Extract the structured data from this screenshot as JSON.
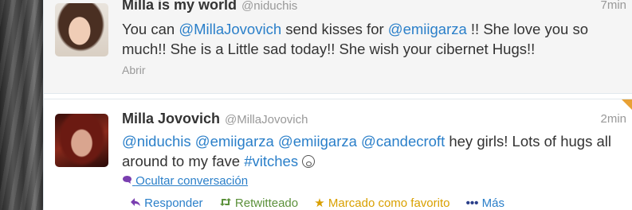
{
  "tweets": [
    {
      "fullname": "Milla is my world",
      "username": "@niduchis",
      "time": "7min",
      "text_parts": [
        {
          "t": "You can ",
          "k": "text"
        },
        {
          "t": "@MillaJovovich",
          "k": "mention"
        },
        {
          "t": " send kisses for ",
          "k": "text"
        },
        {
          "t": "@emiigarza",
          "k": "mention"
        },
        {
          "t": " !! She love you so much!! She is a Little sad today!! She wish your cibernet Hugs!!",
          "k": "text"
        }
      ],
      "expand_label": "Abrir"
    },
    {
      "fullname": "Milla Jovovich",
      "username": "@MillaJovovich",
      "time": "2min",
      "text_parts": [
        {
          "t": "@niduchis",
          "k": "mention"
        },
        {
          "t": " ",
          "k": "text"
        },
        {
          "t": "@emiigarza",
          "k": "mention"
        },
        {
          "t": " ",
          "k": "text"
        },
        {
          "t": "@emiigarza",
          "k": "mention"
        },
        {
          "t": " ",
          "k": "text"
        },
        {
          "t": "@candecroft",
          "k": "mention"
        },
        {
          "t": " hey girls! Lots of hugs all around to my fave ",
          "k": "text"
        },
        {
          "t": "#vitches",
          "k": "hashtag"
        },
        {
          "t": " ",
          "k": "text"
        }
      ],
      "collapse_label": "Ocultar conversación",
      "actions": {
        "reply": "Responder",
        "retweeted": "Retwitteado",
        "favorited": "Marcado como favorito",
        "more": "Más"
      }
    }
  ],
  "colors": {
    "link": "#2a7fc9",
    "text": "#333333",
    "muted": "#999999",
    "retweet": "#5c913b",
    "favorite": "#d9a000",
    "corner_flag": "#e8a134"
  },
  "icons": {
    "reply": "reply-arrow-icon",
    "retweet": "retweet-icon",
    "favorite": "star-icon",
    "more": "more-dots-icon",
    "collapse": "conversation-bubble-icon",
    "emoji": "surprised-face-icon"
  }
}
